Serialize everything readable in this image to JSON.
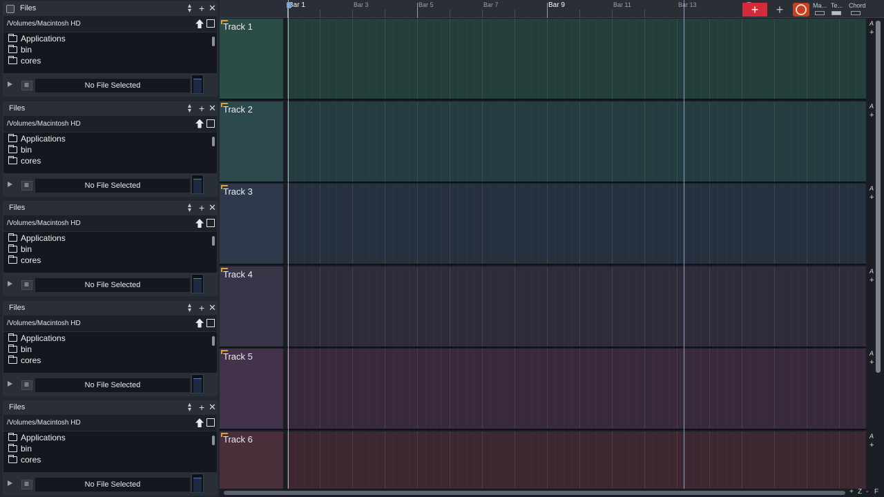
{
  "file_panels": [
    {
      "title": "Files",
      "path": "/Volumes/Macintosh HD",
      "items": [
        "Applications",
        "bin",
        "cores"
      ],
      "status": "No File Selected"
    },
    {
      "title": "Files",
      "path": "/Volumes/Macintosh HD",
      "items": [
        "Applications",
        "bin",
        "cores"
      ],
      "status": "No File Selected"
    },
    {
      "title": "Files",
      "path": "/Volumes/Macintosh HD",
      "items": [
        "Applications",
        "bin",
        "cores"
      ],
      "status": "No File Selected"
    },
    {
      "title": "Files",
      "path": "/Volumes/Macintosh HD",
      "items": [
        "Applications",
        "bin",
        "cores"
      ],
      "status": "No File Selected"
    },
    {
      "title": "Files",
      "path": "/Volumes/Macintosh HD",
      "items": [
        "Applications",
        "bin",
        "cores"
      ],
      "status": "No File Selected"
    }
  ],
  "ruler": {
    "bars": [
      "Bar 1",
      "Bar 3",
      "Bar 5",
      "Bar 7",
      "Bar 9",
      "Bar 11",
      "Bar 13"
    ]
  },
  "toolbar": {
    "add_track_icon": "plus-icon",
    "add_send_icon": "plus-icon",
    "metronome_icon": "metronome-icon",
    "mixer_label": "Ma...",
    "tempo_label": "Te...",
    "chord_label": "Chord"
  },
  "tracks": [
    {
      "name": "Track 1",
      "color": "#2c4c48"
    },
    {
      "name": "Track 2",
      "color": "#2c4a4e"
    },
    {
      "name": "Track 3",
      "color": "#2e3a4c"
    },
    {
      "name": "Track 4",
      "color": "#3a3448"
    },
    {
      "name": "Track 5",
      "color": "#44324a"
    },
    {
      "name": "Track 6",
      "color": "#4a2f3a"
    }
  ],
  "right_strip": {
    "a_label": "A",
    "plus_label": "+"
  },
  "zoom": {
    "plus": "+",
    "z": "Z",
    "minus": "-",
    "f": "F"
  }
}
